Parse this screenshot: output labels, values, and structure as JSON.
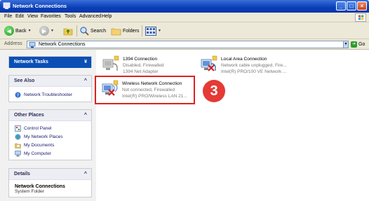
{
  "window": {
    "title": "Network Connections"
  },
  "menu": [
    "File",
    "Edit",
    "View",
    "Favorites",
    "Tools",
    "Advanced",
    "Help"
  ],
  "toolbar": {
    "back_label": "Back",
    "search_label": "Search",
    "folders_label": "Folders"
  },
  "address": {
    "label": "Address",
    "value": "Network Connections",
    "go_label": "Go"
  },
  "sidebar": {
    "network_tasks": {
      "title": "Network Tasks"
    },
    "see_also": {
      "title": "See Also",
      "items": [
        "Network Troubleshooter"
      ]
    },
    "other_places": {
      "title": "Other Places",
      "items": [
        "Control Panel",
        "My Network Places",
        "My Documents",
        "My Computer"
      ]
    },
    "details": {
      "title": "Details",
      "name": "Network Connections",
      "type": "System Folder"
    }
  },
  "connections": [
    {
      "name": "1394 Connection",
      "status": "Disabled, Firewalled",
      "device": "1394 Net Adapter"
    },
    {
      "name": "Local Area Connection",
      "status": "Network cable unplugged, Fire...",
      "device": "Intel(R) PRO/100 VE Network ..."
    },
    {
      "name": "Wireless Network Connection",
      "status": "Not connected, Firewalled",
      "device": "Intel(R) PRO/Wireless LAN 21..."
    }
  ],
  "callout": {
    "number": "3"
  },
  "colors": {
    "title_bar": "#0a3fb8",
    "task_header": "#0b4fb5",
    "highlight": "#e02020",
    "callout": "#e53a35"
  }
}
